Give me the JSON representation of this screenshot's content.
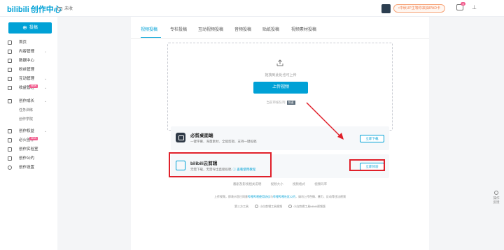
{
  "header": {
    "logo_mark": "bilibili",
    "logo_sub": "创作中心",
    "mail_label": "未收",
    "promo_text": "•中秋UP主等你来抽IPAD卡",
    "notification_count": "3"
  },
  "sidebar": {
    "post_button": "投稿",
    "items": [
      {
        "label": "首页",
        "chevron": "",
        "badge": ""
      },
      {
        "label": "内容管理",
        "chevron": "⌄",
        "badge": ""
      },
      {
        "label": "数据中心",
        "chevron": "",
        "badge": ""
      },
      {
        "label": "粉丝管理",
        "chevron": "",
        "badge": ""
      },
      {
        "label": "互动管理",
        "chevron": "⌄",
        "badge": ""
      },
      {
        "label": "收益管理",
        "chevron": "⌄",
        "badge": "NEW"
      },
      {
        "label": "创作成长",
        "chevron": "⌄",
        "badge": ""
      },
      {
        "label": "任务训练",
        "chevron": "",
        "badge": ""
      },
      {
        "label": "创作学院",
        "chevron": "",
        "badge": ""
      },
      {
        "label": "创作权益",
        "chevron": "⌄",
        "badge": ""
      },
      {
        "label": "必火创作",
        "chevron": "",
        "badge": "NEW"
      },
      {
        "label": "创作实验室",
        "chevron": "",
        "badge": ""
      },
      {
        "label": "创作公约",
        "chevron": "",
        "badge": ""
      },
      {
        "label": "创作设置",
        "chevron": "",
        "badge": ""
      }
    ]
  },
  "tabs": [
    "视频投稿",
    "专栏投稿",
    "互动视频投稿",
    "音频投稿",
    "贴纸投稿",
    "视频素材投稿"
  ],
  "upload": {
    "hint": "拖拽到此处也可上传",
    "button": "上传视频",
    "offline_note": "当前审核队列",
    "offline_chip": "快速"
  },
  "cards": [
    {
      "title": "必剪桌面端",
      "desc": "一键字幕、海量素材、全能剪辑、支持一键投稿",
      "link": "",
      "button": "立即下载"
    },
    {
      "title": "bilibili云剪辑",
      "desc": "无需下载，无需导出直接投稿",
      "link": "ⓘ 查看使用教程",
      "button": "立即体验"
    }
  ],
  "footer": {
    "links": [
      "番剧及影视相关说明",
      "视频大小",
      "视频格式",
      "视频码率"
    ],
    "notice": "上传视频，即表示您已同意",
    "notice_link1": "哔哩哔哩使用协议",
    "notice_mid": "与",
    "notice_link2": "哔哩哔哩社区公约",
    "notice_tail": "，请勿上传色情、暴力、反动等违法视频",
    "third_party_label": "第三方工具",
    "third_party": [
      "小白剪辑工具视频",
      "小白剪辑工具bilibili视频版"
    ]
  },
  "feedback": "操作反馈"
}
